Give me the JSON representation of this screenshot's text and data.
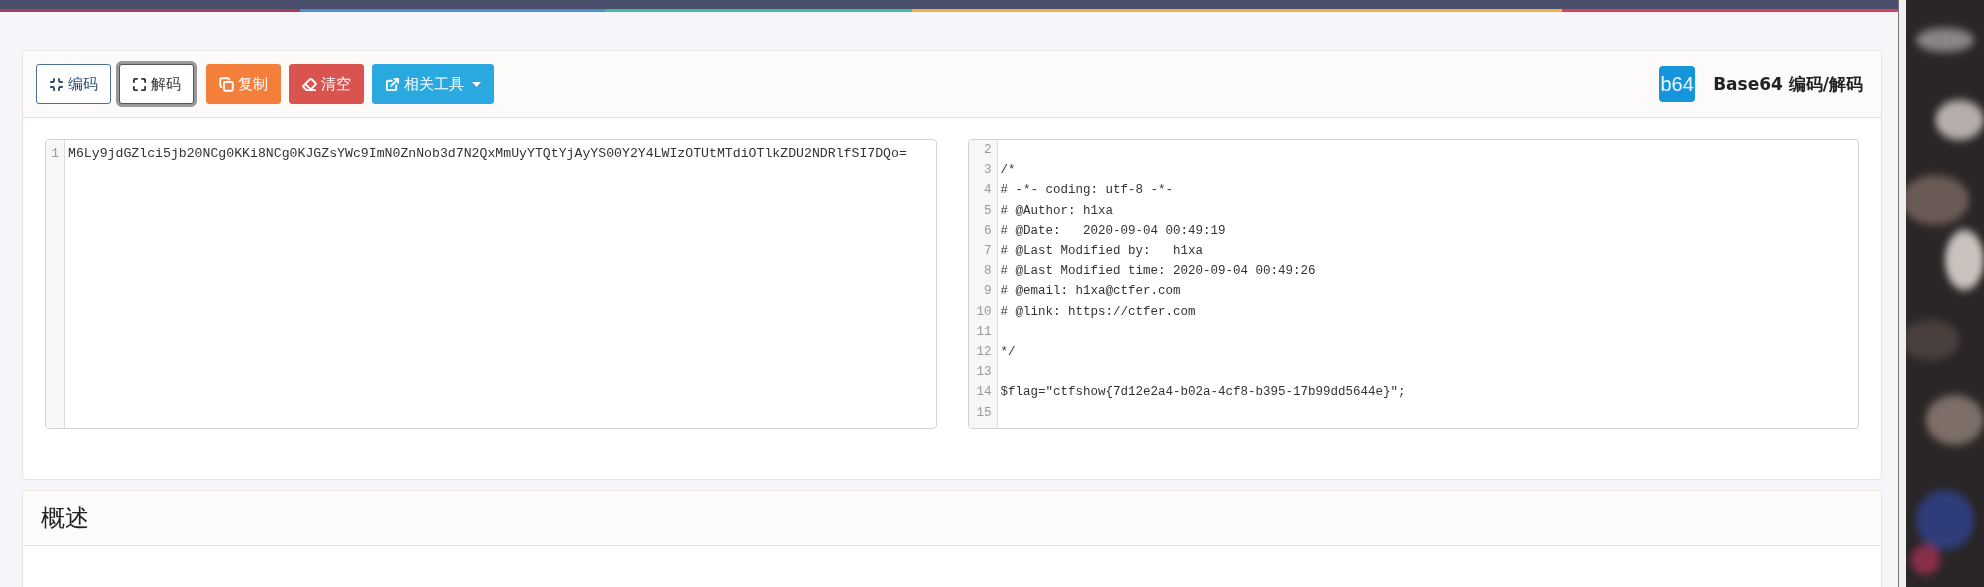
{
  "toolbar": {
    "buttons": [
      {
        "kind": "encode",
        "label": "编码",
        "selected": false
      },
      {
        "kind": "decode",
        "label": "解码",
        "selected": true
      },
      {
        "kind": "copy",
        "label": "复制"
      },
      {
        "kind": "clear",
        "label": "清空"
      },
      {
        "kind": "tools",
        "label": "相关工具"
      }
    ]
  },
  "title": {
    "logo": "b64",
    "text": "Base64 编码/解码"
  },
  "input_editor": {
    "lines": [
      {
        "number": "1",
        "text": "M6Ly9jdGZlci5jb20NCg0KKi8NCg0KJGZsYWc9ImN0ZnNob3d7N2QxMmUyYTQtYjAyYS00Y2Y4LWIzOTUtMTdiOTlkZDU2NDRlfSI7DQo="
      }
    ]
  },
  "output_editor": {
    "lines": [
      {
        "number": "2"
      },
      {
        "number": "3",
        "text": "/*"
      },
      {
        "number": "4",
        "text": "# -*- coding: utf-8 -*-"
      },
      {
        "number": "5",
        "text": "# @Author: h1xa"
      },
      {
        "number": "6",
        "text": "# @Date:   2020-09-04 00:49:19"
      },
      {
        "number": "7",
        "text": "# @Last Modified by:   h1xa"
      },
      {
        "number": "8",
        "text": "# @Last Modified time: 2020-09-04 00:49:26"
      },
      {
        "number": "9",
        "text": "# @email: h1xa@ctfer.com"
      },
      {
        "number": "10",
        "text": "# @link: https://ctfer.com"
      },
      {
        "number": "11"
      },
      {
        "number": "12",
        "text": "*/"
      },
      {
        "number": "13"
      },
      {
        "number": "14",
        "text": "$flag=\"ctfshow{7d12e2a4-b02a-4cf8-b395-17b99dd5644e}\";"
      },
      {
        "number": "15"
      }
    ]
  },
  "overview": {
    "title": "概述"
  }
}
